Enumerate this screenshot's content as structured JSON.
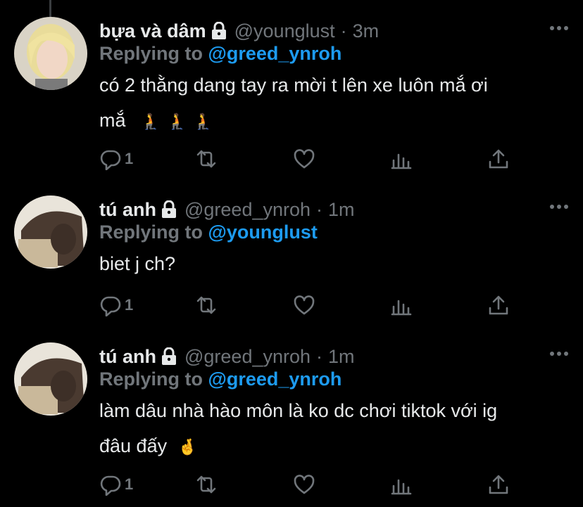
{
  "replying_prefix": "Replying to",
  "tweets": [
    {
      "name": "bựa và dâm",
      "handle": "@younglust",
      "time": "3m",
      "reply_to": "@greed_ynroh",
      "text_line1": "có 2 thằng dang tay ra mời t lên xe luôn mắ ơi",
      "text_line2": "mắ",
      "emojis": [
        "🧎",
        "🧎",
        "🧎"
      ],
      "reply_count": "1"
    },
    {
      "name": "tú anh",
      "handle": "@greed_ynroh",
      "time": "1m",
      "reply_to": "@younglust",
      "text_line1": "biet j ch?",
      "text_line2": "",
      "emojis": [],
      "reply_count": "1"
    },
    {
      "name": "tú anh",
      "handle": "@greed_ynroh",
      "time": "1m",
      "reply_to": "@greed_ynroh",
      "text_line1": "làm dâu nhà hào môn là ko dc chơi tiktok với ig",
      "text_line2": "đâu đấy",
      "emojis": [
        "🤞"
      ],
      "reply_count": "1"
    }
  ],
  "separator": "·",
  "colors": {
    "accent": "#1d9bf0",
    "muted": "#71767b",
    "text": "#e7e9ea",
    "background": "#000000"
  },
  "icons": [
    "lock-icon",
    "more-icon",
    "reply-icon",
    "retweet-icon",
    "like-icon",
    "analytics-icon",
    "share-icon"
  ]
}
